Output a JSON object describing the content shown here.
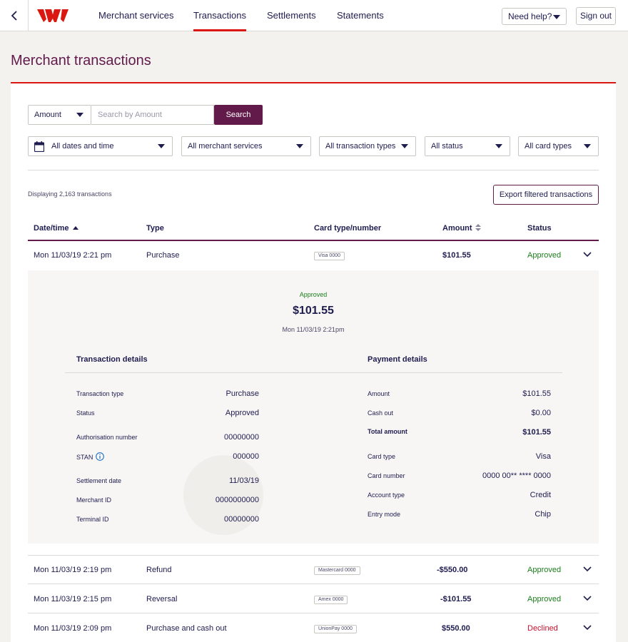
{
  "header": {
    "nav": [
      {
        "label": "Merchant services"
      },
      {
        "label": "Transactions"
      },
      {
        "label": "Settlements"
      },
      {
        "label": "Statements"
      }
    ],
    "help_label": "Need help?",
    "signout_label": "Sign out",
    "brand_color": "#da1710"
  },
  "page": {
    "title": "Merchant transactions"
  },
  "search": {
    "field_select": "Amount",
    "placeholder": "Search by Amount",
    "button": "Search"
  },
  "filters": {
    "dates": "All dates and time",
    "services": "All merchant services",
    "types": "All transaction types",
    "status": "All status",
    "cards": "All card types"
  },
  "summary": {
    "count_text": "Displaying 2,163 transactions",
    "export_label": "Export filtered transactions"
  },
  "table": {
    "headers": {
      "date": "Date/time",
      "type": "Type",
      "card": "Card type/number",
      "amount": "Amount",
      "status": "Status"
    },
    "rows": [
      {
        "date": "Mon 11/03/19 2:21 pm",
        "type": "Purchase",
        "card": "Visa 0000",
        "amount": "$101.55",
        "status": "Approved"
      },
      {
        "date": "Mon 11/03/19 2:19 pm",
        "type": "Refund",
        "card": "Mastercard 0000",
        "amount": "-$550.00",
        "status": "Approved"
      },
      {
        "date": "Mon 11/03/19 2:15 pm",
        "type": "Reversal",
        "card": "Amex 0000",
        "amount": "-$101.55",
        "status": "Approved"
      },
      {
        "date": "Mon 11/03/19 2:09 pm",
        "type": "Purchase and cash out",
        "card": "UnionPay 0000",
        "amount": "$550.00",
        "status": "Declined"
      }
    ]
  },
  "detail": {
    "status": "Approved",
    "amount": "$101.55",
    "date": "Mon 11/03/19 2:21pm",
    "transaction_heading": "Transaction details",
    "payment_heading": "Payment details",
    "transaction": {
      "type_label": "Transaction type",
      "type_value": "Purchase",
      "status_label": "Status",
      "status_value": "Approved",
      "auth_label": "Authorisation number",
      "auth_value": "00000000",
      "stan_label": "STAN",
      "stan_value": "000000",
      "settle_label": "Settlement date",
      "settle_value": "11/03/19",
      "merchant_label": "Merchant ID",
      "merchant_value": "0000000000",
      "terminal_label": "Terminal ID",
      "terminal_value": "00000000"
    },
    "payment": {
      "amount_label": "Amount",
      "amount_value": "$101.55",
      "cashout_label": "Cash out",
      "cashout_value": "$0.00",
      "total_label": "Total amount",
      "total_value": "$101.55",
      "cardtype_label": "Card type",
      "cardtype_value": "Visa",
      "cardnum_label": "Card number",
      "cardnum_value": "0000 00** **** 0000",
      "account_label": "Account type",
      "account_value": "Credit",
      "entry_label": "Entry mode",
      "entry_value": "Chip"
    }
  },
  "colors": {
    "primary": "#621a4b",
    "approved": "#1a7f1a",
    "declined": "#c8102e"
  }
}
